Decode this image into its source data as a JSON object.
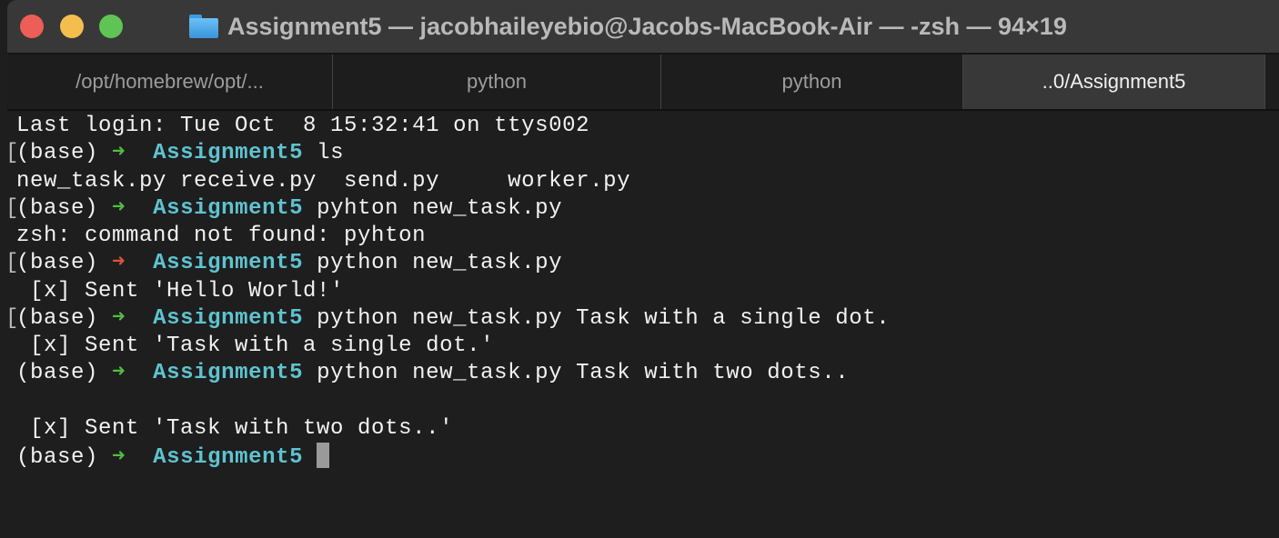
{
  "window": {
    "title": "Assignment5 — jacobhaileyebio@Jacobs-MacBook-Air — -zsh — 94×19",
    "icon": "folder-icon"
  },
  "tabs": [
    {
      "label": "/opt/homebrew/opt/...",
      "active": false
    },
    {
      "label": "python",
      "active": false
    },
    {
      "label": "python",
      "active": false
    },
    {
      "label": "..0/Assignment5",
      "active": true
    }
  ],
  "colors": {
    "arrow_ok": "#4fbf40",
    "arrow_err": "#d9553b",
    "dir": "#5ec3d0",
    "text": "#f2f2f2"
  },
  "terminal": {
    "lines": [
      {
        "bracket": false,
        "segments": [
          {
            "t": "Last login: Tue Oct  8 15:32:41 on ttys002",
            "c": "text"
          }
        ]
      },
      {
        "bracket": true,
        "segments": [
          {
            "t": "(base) ",
            "c": "text"
          },
          {
            "t": "➜",
            "c": "arrow_ok"
          },
          {
            "t": "  ",
            "c": "text"
          },
          {
            "t": "Assignment5",
            "c": "dir"
          },
          {
            "t": " ls",
            "c": "text"
          }
        ]
      },
      {
        "bracket": false,
        "segments": [
          {
            "t": "new_task.py receive.py  send.py     worker.py",
            "c": "text"
          }
        ]
      },
      {
        "bracket": true,
        "segments": [
          {
            "t": "(base) ",
            "c": "text"
          },
          {
            "t": "➜",
            "c": "arrow_ok"
          },
          {
            "t": "  ",
            "c": "text"
          },
          {
            "t": "Assignment5",
            "c": "dir"
          },
          {
            "t": " pyhton new_task.py",
            "c": "text"
          }
        ]
      },
      {
        "bracket": false,
        "segments": [
          {
            "t": "zsh: command not found: pyhton",
            "c": "text"
          }
        ]
      },
      {
        "bracket": true,
        "segments": [
          {
            "t": "(base) ",
            "c": "text"
          },
          {
            "t": "➜",
            "c": "arrow_err"
          },
          {
            "t": "  ",
            "c": "text"
          },
          {
            "t": "Assignment5",
            "c": "dir"
          },
          {
            "t": " python new_task.py",
            "c": "text"
          }
        ]
      },
      {
        "bracket": false,
        "segments": [
          {
            "t": " [x] Sent 'Hello World!'",
            "c": "text"
          }
        ]
      },
      {
        "bracket": true,
        "segments": [
          {
            "t": "(base) ",
            "c": "text"
          },
          {
            "t": "➜",
            "c": "arrow_ok"
          },
          {
            "t": "  ",
            "c": "text"
          },
          {
            "t": "Assignment5",
            "c": "dir"
          },
          {
            "t": " python new_task.py Task with a single dot.",
            "c": "text"
          }
        ]
      },
      {
        "bracket": false,
        "segments": [
          {
            "t": " [x] Sent 'Task with a single dot.'",
            "c": "text"
          }
        ]
      },
      {
        "bracket": false,
        "segments": [
          {
            "t": "(base) ",
            "c": "text"
          },
          {
            "t": "➜",
            "c": "arrow_ok"
          },
          {
            "t": "  ",
            "c": "text"
          },
          {
            "t": "Assignment5",
            "c": "dir"
          },
          {
            "t": " python new_task.py Task with two dots..",
            "c": "text"
          }
        ]
      },
      {
        "bracket": false,
        "segments": [
          {
            "t": "",
            "c": "text"
          }
        ]
      },
      {
        "bracket": false,
        "segments": [
          {
            "t": " [x] Sent 'Task with two dots..'",
            "c": "text"
          }
        ]
      },
      {
        "bracket": false,
        "cursor": true,
        "segments": [
          {
            "t": "(base) ",
            "c": "text"
          },
          {
            "t": "➜",
            "c": "arrow_ok"
          },
          {
            "t": "  ",
            "c": "text"
          },
          {
            "t": "Assignment5",
            "c": "dir"
          },
          {
            "t": " ",
            "c": "text"
          }
        ]
      }
    ]
  }
}
